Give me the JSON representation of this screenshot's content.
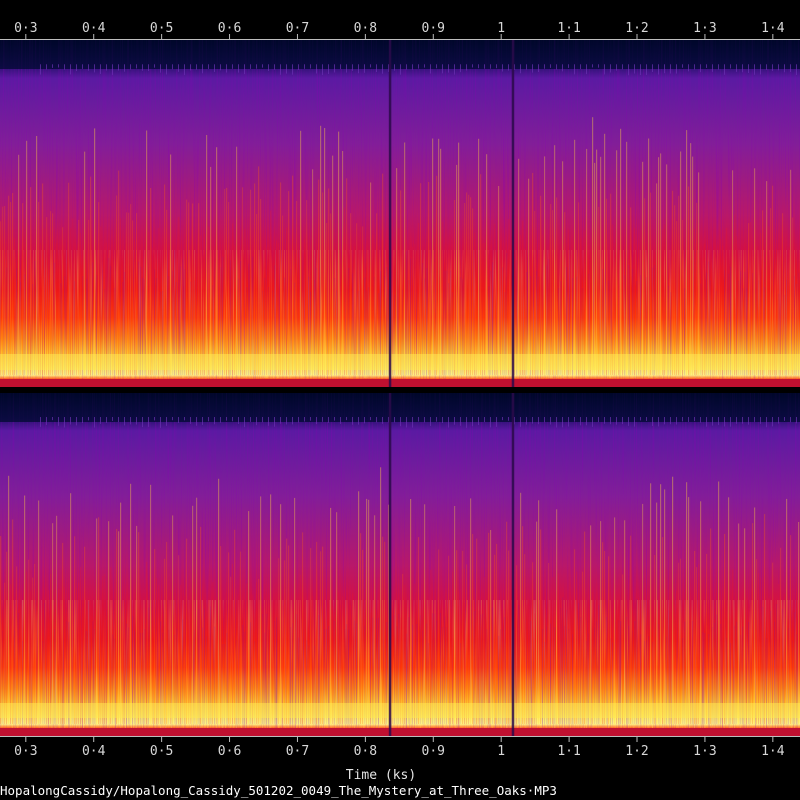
{
  "chart_data": {
    "type": "heatmap",
    "subtype": "spectrogram",
    "channels": 2,
    "xlabel": "Time (ks)",
    "xlim": [
      0.262,
      1.44
    ],
    "x_ticks": [
      0.3,
      0.4,
      0.5,
      0.6,
      0.7,
      0.8,
      0.9,
      1,
      1.1,
      1.2,
      1.3,
      1.4
    ],
    "x_tick_labels": [
      "0·3",
      "0·4",
      "0·5",
      "0·6",
      "0·7",
      "0·8",
      "0·9",
      "1",
      "1·1",
      "1·2",
      "1·3",
      "1·4"
    ],
    "file_label": "HopalongCassidy/Hopalong_Cassidy_501202_0049_The_Mystery_at_Three_Oaks·MP3",
    "colormap": [
      "#000010",
      "#1a0a5a",
      "#5a1a9a",
      "#a0207a",
      "#e01020",
      "#ff5000",
      "#ffb020",
      "#ffff80"
    ],
    "segment_boundaries_ks": [
      0.836,
      1.017
    ],
    "grid": false,
    "legend": "none"
  }
}
